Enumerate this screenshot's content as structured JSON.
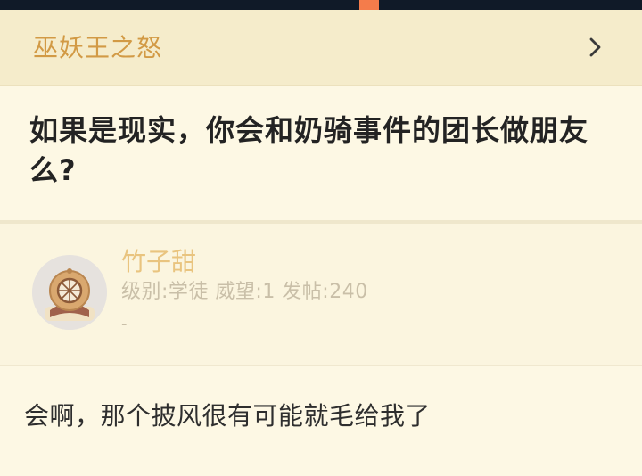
{
  "status_bar": {
    "indicator_color": "#f47c4b",
    "background_color": "#101a28"
  },
  "forum": {
    "name": "巫妖王之怒",
    "chevron_icon": "chevron-right-icon"
  },
  "thread": {
    "title": "如果是现实，你会和奶骑事件的团长做朋友么?"
  },
  "author": {
    "name": "竹子甜",
    "meta": "级别:学徒 威望:1 发帖:240",
    "signature": "-",
    "avatar_icon": "diving-helmet-avatar"
  },
  "post": {
    "content": "会啊，那个披风很有可能就毛给我了"
  },
  "colors": {
    "accent": "#d29a45",
    "author_name": "#e9c47f",
    "header_bg": "#f5eccb",
    "page_bg": "#fdf8e4"
  }
}
